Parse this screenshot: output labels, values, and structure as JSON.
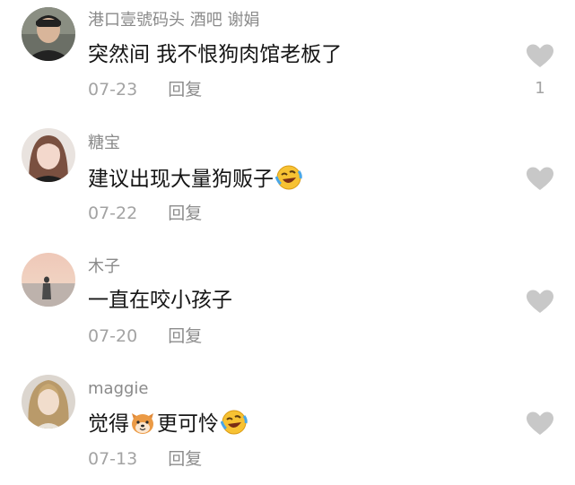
{
  "comments": [
    {
      "username": "港口壹號码头 酒吧 谢娟",
      "text": "突然间 我不恨狗肉馆老板了",
      "date": "07-23",
      "reply_label": "回复",
      "likes": "1",
      "avatar_icon": "man-portrait-avatar"
    },
    {
      "username": "糖宝",
      "text": "建议出现大量狗贩子",
      "date": "07-22",
      "reply_label": "回复",
      "likes": "",
      "emoji": "rolling-laugh-emoji",
      "avatar_icon": "woman-selfie-avatar"
    },
    {
      "username": "木子",
      "text": "一直在咬小孩子",
      "date": "07-20",
      "reply_label": "回复",
      "likes": "",
      "avatar_icon": "sunset-figure-avatar"
    },
    {
      "username": "maggie",
      "text_before": "觉得",
      "text_after": "更可怜",
      "date": "07-13",
      "reply_label": "回复",
      "likes": "",
      "inline_emoji": "shiba-dog-emoji",
      "emoji": "rolling-laugh-emoji",
      "avatar_icon": "blonde-woman-avatar"
    }
  ],
  "colors": {
    "username": "#8a8a8a",
    "text": "#161616",
    "meta": "#a3a3a3",
    "heart": "#c8c8c8"
  }
}
